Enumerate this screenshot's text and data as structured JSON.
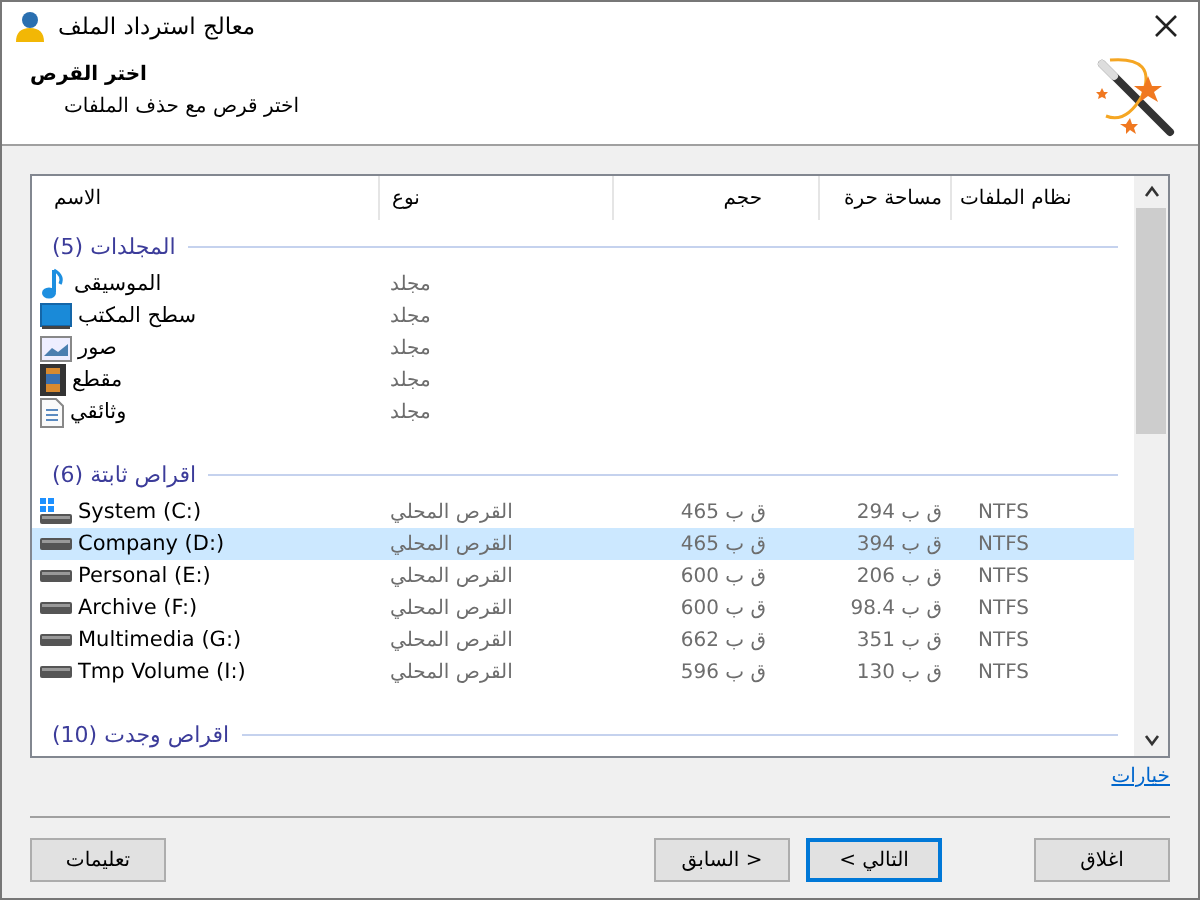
{
  "window": {
    "title": "معالج استرداد الملف"
  },
  "header": {
    "title": "اختر القرص",
    "subtitle": "اختر قرص مع حذف الملفات"
  },
  "table": {
    "columns": [
      "نظام الملفات",
      "مساحة حرة",
      "حجم",
      "نوع",
      "الاسم"
    ],
    "groups": [
      {
        "title": "المجلدات (5)",
        "rows": [
          {
            "kind": "music",
            "name": "الموسيقى",
            "type": "مجلد",
            "selected": false
          },
          {
            "kind": "desktop",
            "name": "سطح المكتب",
            "type": "مجلد",
            "selected": false
          },
          {
            "kind": "pictures",
            "name": "صور",
            "type": "مجلد",
            "selected": false
          },
          {
            "kind": "video",
            "name": "مقطع",
            "type": "مجلد",
            "selected": false
          },
          {
            "kind": "documents",
            "name": "وثائقي",
            "type": "مجلد",
            "selected": false
          }
        ]
      },
      {
        "title": "اقراص ثابتة (6)",
        "rows": [
          {
            "kind": "system-drive",
            "name": "System (C:)",
            "type": "القرص المحلي",
            "size": "ق ب 465",
            "free": "ق ب 294",
            "fs": "NTFS",
            "selected": false
          },
          {
            "kind": "drive",
            "name": "Company (D:)",
            "type": "القرص المحلي",
            "size": "ق ب 465",
            "free": "ق ب 394",
            "fs": "NTFS",
            "selected": true
          },
          {
            "kind": "drive",
            "name": "Personal (E:)",
            "type": "القرص المحلي",
            "size": "ق ب 600",
            "free": "ق ب 206",
            "fs": "NTFS",
            "selected": false
          },
          {
            "kind": "drive",
            "name": "Archive (F:)",
            "type": "القرص المحلي",
            "size": "ق ب 600",
            "free": "ق ب 98.4",
            "fs": "NTFS",
            "selected": false
          },
          {
            "kind": "drive",
            "name": "Multimedia (G:)",
            "type": "القرص المحلي",
            "size": "ق ب 662",
            "free": "ق ب 351",
            "fs": "NTFS",
            "selected": false
          },
          {
            "kind": "drive",
            "name": "Tmp Volume (I:)",
            "type": "القرص المحلي",
            "size": "ق ب 596",
            "free": "ق ب 130",
            "fs": "NTFS",
            "selected": false
          }
        ]
      },
      {
        "title": "اقراص وجدت (10)"
      }
    ]
  },
  "options_link": "خيارات",
  "buttons": [
    {
      "kind": "close",
      "label": "اغلاق",
      "default": false
    },
    {
      "kind": "next",
      "label": "< التالي",
      "default": true
    },
    {
      "kind": "back",
      "label": "السابق >",
      "default": false
    },
    {
      "kind": "help",
      "label": "تعليمات",
      "default": false
    }
  ]
}
